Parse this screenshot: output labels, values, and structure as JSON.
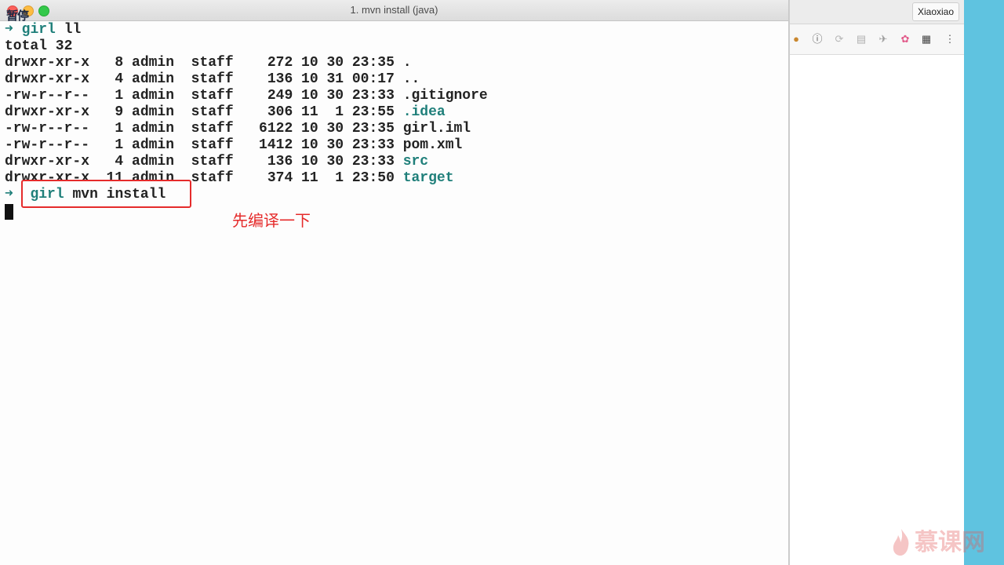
{
  "window": {
    "title": "1. mvn install (java)",
    "overlay_label": "暂停"
  },
  "browser": {
    "profile_button": "Xiaoxiao",
    "extension_icons": [
      "cookie-icon",
      "info-icon",
      "sync-icon",
      "page-icon",
      "bird-icon",
      "color-wheel-icon",
      "qr-code-icon",
      "more-vertical-icon"
    ]
  },
  "terminal": {
    "prompt_arrow": "➜",
    "prompt_dir": "girl",
    "first_command": " ll",
    "total": "total 32",
    "listing": [
      {
        "perms": "drwxr-xr-x",
        "links": "8",
        "owner": "admin",
        "group": "staff",
        "size": "272",
        "date": "10 30 23:35",
        "name": ".",
        "is_dir": false
      },
      {
        "perms": "drwxr-xr-x",
        "links": "4",
        "owner": "admin",
        "group": "staff",
        "size": "136",
        "date": "10 31 00:17",
        "name": "..",
        "is_dir": false
      },
      {
        "perms": "-rw-r--r--",
        "links": "1",
        "owner": "admin",
        "group": "staff",
        "size": "249",
        "date": "10 30 23:33",
        "name": ".gitignore",
        "is_dir": false
      },
      {
        "perms": "drwxr-xr-x",
        "links": "9",
        "owner": "admin",
        "group": "staff",
        "size": "306",
        "date": "11  1 23:55",
        "name": ".idea",
        "is_dir": true
      },
      {
        "perms": "-rw-r--r--",
        "links": "1",
        "owner": "admin",
        "group": "staff",
        "size": "6122",
        "date": "10 30 23:35",
        "name": "girl.iml",
        "is_dir": false
      },
      {
        "perms": "-rw-r--r--",
        "links": "1",
        "owner": "admin",
        "group": "staff",
        "size": "1412",
        "date": "10 30 23:33",
        "name": "pom.xml",
        "is_dir": false
      },
      {
        "perms": "drwxr-xr-x",
        "links": "4",
        "owner": "admin",
        "group": "staff",
        "size": "136",
        "date": "10 30 23:33",
        "name": "src",
        "is_dir": true
      },
      {
        "perms": "drwxr-xr-x",
        "links": "11",
        "owner": "admin",
        "group": "staff",
        "size": "374",
        "date": "11  1 23:50",
        "name": "target",
        "is_dir": true
      }
    ],
    "second_command": " mvn install"
  },
  "annotation": "先编译一下",
  "watermark": "慕课网",
  "colors": {
    "accent_teal": "#1f7f7a",
    "annotation_red": "#e52b2b",
    "desktop_blue": "#5fc3e0"
  }
}
